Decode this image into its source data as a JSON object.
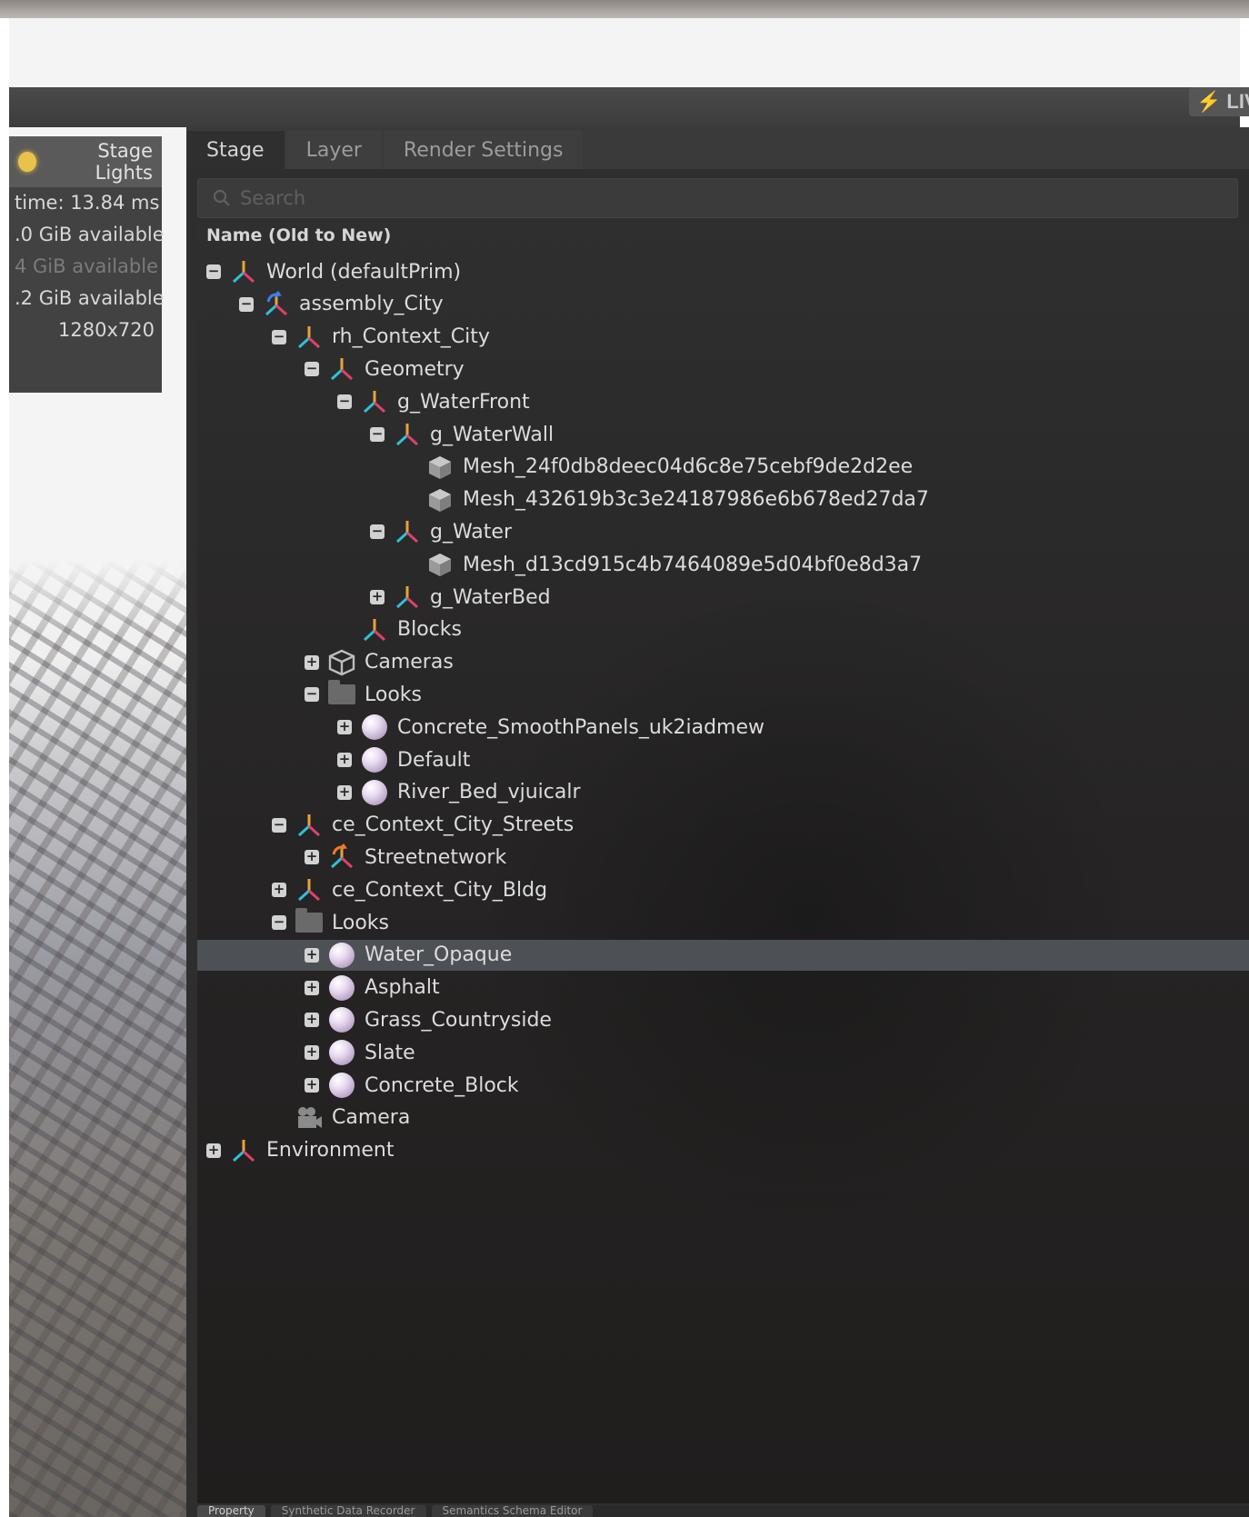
{
  "header": {
    "live_label": "LIV"
  },
  "viewport": {
    "hud_title": "Stage Lights",
    "hud_lines": [
      "time: 13.84 ms",
      ".0 GiB available",
      "4 GiB available",
      ".2 GiB available",
      "1280x720"
    ]
  },
  "panel": {
    "tabs": [
      {
        "label": "Stage",
        "active": true
      },
      {
        "label": "Layer",
        "active": false
      },
      {
        "label": "Render Settings",
        "active": false
      }
    ],
    "search_placeholder": "Search",
    "column_header": "Name (Old to New)"
  },
  "tree": [
    {
      "label": "World (defaultPrim)",
      "depth": 0,
      "expander": "minus",
      "icon": "xform-icon"
    },
    {
      "label": "assembly_City",
      "depth": 1,
      "expander": "minus",
      "icon": "xform-ref-icon"
    },
    {
      "label": "rh_Context_City",
      "depth": 2,
      "expander": "minus",
      "icon": "xform-icon"
    },
    {
      "label": "Geometry",
      "depth": 3,
      "expander": "minus",
      "icon": "xform-icon"
    },
    {
      "label": "g_WaterFront",
      "depth": 4,
      "expander": "minus",
      "icon": "xform-icon"
    },
    {
      "label": "g_WaterWall",
      "depth": 5,
      "expander": "minus",
      "icon": "xform-icon"
    },
    {
      "label": "Mesh_24f0db8deec04d6c8e75cebf9de2d2ee",
      "depth": 6,
      "expander": "none",
      "icon": "mesh-icon"
    },
    {
      "label": "Mesh_432619b3c3e24187986e6b678ed27da7",
      "depth": 6,
      "expander": "none",
      "icon": "mesh-icon"
    },
    {
      "label": "g_Water",
      "depth": 5,
      "expander": "minus",
      "icon": "xform-icon"
    },
    {
      "label": "Mesh_d13cd915c4b7464089e5d04bf0e8d3a7",
      "depth": 6,
      "expander": "none",
      "icon": "mesh-icon"
    },
    {
      "label": "g_WaterBed",
      "depth": 5,
      "expander": "plus",
      "icon": "xform-icon"
    },
    {
      "label": "Blocks",
      "depth": 4,
      "expander": "none",
      "icon": "xform-icon"
    },
    {
      "label": "Cameras",
      "depth": 3,
      "expander": "plus",
      "icon": "camera-box-icon"
    },
    {
      "label": "Looks",
      "depth": 3,
      "expander": "minus",
      "icon": "folder-icon"
    },
    {
      "label": "Concrete_SmoothPanels_uk2iadmew",
      "depth": 4,
      "expander": "plus",
      "icon": "material-icon"
    },
    {
      "label": "Default",
      "depth": 4,
      "expander": "plus",
      "icon": "material-icon"
    },
    {
      "label": "River_Bed_vjuicalr",
      "depth": 4,
      "expander": "plus",
      "icon": "material-icon"
    },
    {
      "label": "ce_Context_City_Streets",
      "depth": 2,
      "expander": "minus",
      "icon": "xform-icon"
    },
    {
      "label": "Streetnetwork",
      "depth": 3,
      "expander": "plus",
      "icon": "xform-payload-icon"
    },
    {
      "label": "ce_Context_City_Bldg",
      "depth": 2,
      "expander": "plus",
      "icon": "xform-icon"
    },
    {
      "label": "Looks",
      "depth": 2,
      "expander": "minus",
      "icon": "folder-icon"
    },
    {
      "label": "Water_Opaque",
      "depth": 3,
      "expander": "plus",
      "icon": "material-icon",
      "selected": true
    },
    {
      "label": "Asphalt",
      "depth": 3,
      "expander": "plus",
      "icon": "material-icon"
    },
    {
      "label": "Grass_Countryside",
      "depth": 3,
      "expander": "plus",
      "icon": "material-icon"
    },
    {
      "label": "Slate",
      "depth": 3,
      "expander": "plus",
      "icon": "material-icon"
    },
    {
      "label": "Concrete_Block",
      "depth": 3,
      "expander": "plus",
      "icon": "material-icon"
    },
    {
      "label": "Camera",
      "depth": 2,
      "expander": "none",
      "icon": "camera-icon"
    },
    {
      "label": "Environment",
      "depth": 0,
      "expander": "plus",
      "icon": "xform-icon"
    }
  ],
  "bottom_tabs": [
    {
      "label": "Property",
      "active": true
    },
    {
      "label": "Synthetic Data Recorder",
      "active": false
    },
    {
      "label": "Semantics Schema Editor",
      "active": false
    }
  ]
}
